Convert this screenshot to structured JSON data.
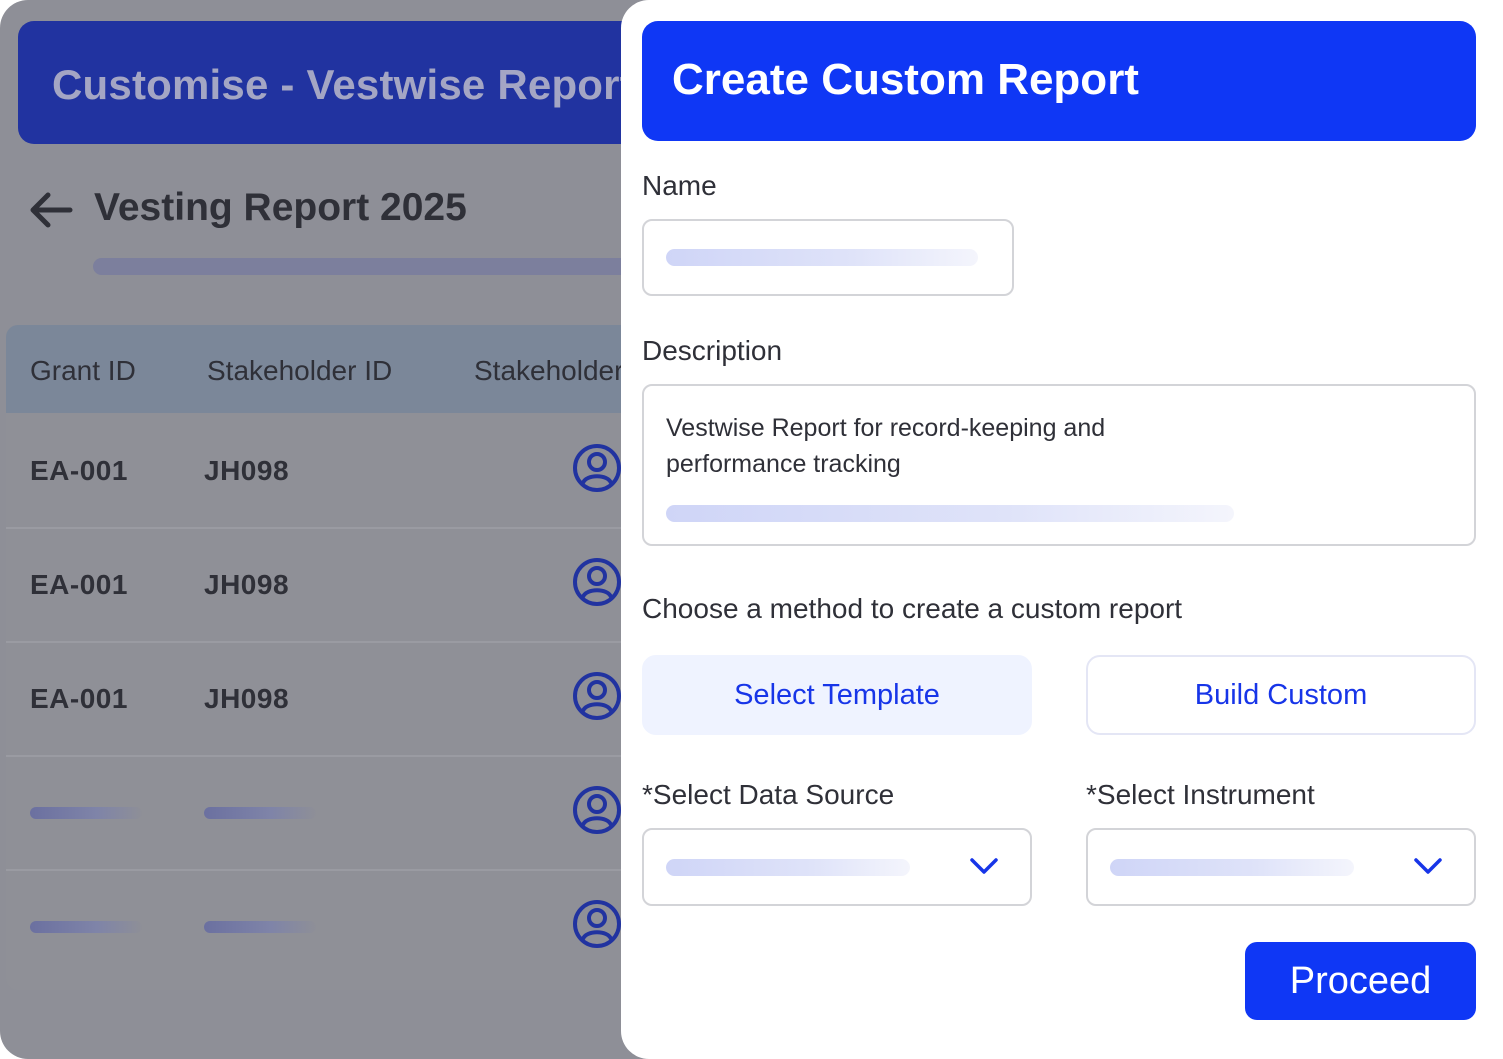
{
  "background_app": {
    "header_title": "Customise - Vestwise Report",
    "report_title": "Vesting Report 2025",
    "table": {
      "columns": [
        "Grant ID",
        "Stakeholder ID",
        "Stakeholder"
      ],
      "rows": [
        {
          "grant_id": "EA-001",
          "stakeholder_id": "JH098"
        },
        {
          "grant_id": "EA-001",
          "stakeholder_id": "JH098"
        },
        {
          "grant_id": "EA-001",
          "stakeholder_id": "JH098"
        }
      ]
    }
  },
  "modal": {
    "title": "Create Custom Report",
    "name_label": "Name",
    "description_label": "Description",
    "description_value": "Vestwise Report for record-keeping and performance tracking",
    "method_prompt": "Choose a method to create a custom report",
    "methods": {
      "template_label": "Select Template",
      "custom_label": "Build Custom",
      "selected": "template"
    },
    "data_source_label": "*Select Data Source",
    "instrument_label": "*Select Instrument",
    "proceed_label": "Proceed"
  },
  "colors": {
    "accent": "#0f37f5",
    "background_header": "#2133a0",
    "overlay": "#8e8f97",
    "avatar_icon": "#2133a0"
  },
  "icons": [
    "arrow-left-icon",
    "user-avatar-icon",
    "chevron-down-icon"
  ]
}
